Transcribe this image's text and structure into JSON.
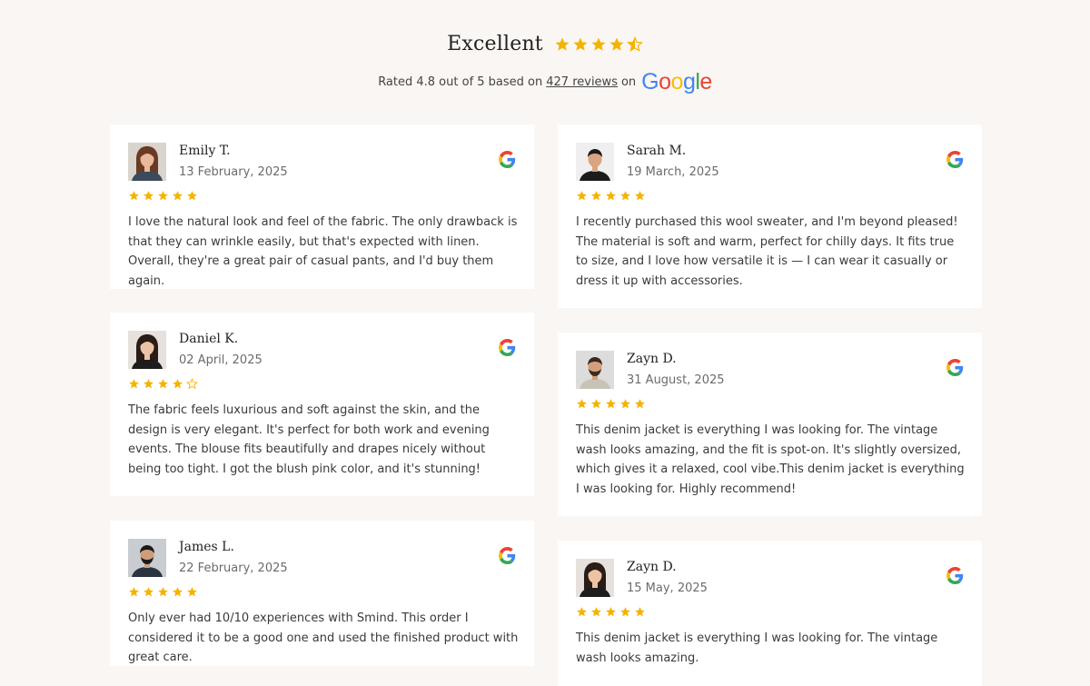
{
  "header": {
    "title": "Excellent",
    "overall_rating": 4.5,
    "rated_prefix": "Rated 4.8 out of 5 based on",
    "reviews_link": "427 reviews",
    "on_text": "on",
    "google_letters": [
      "G",
      "o",
      "o",
      "g",
      "l",
      "e"
    ],
    "google_colors": [
      "#4285F4",
      "#EA4335",
      "#FBBC05",
      "#4285F4",
      "#34A853",
      "#EA4335"
    ]
  },
  "colors": {
    "star": "#f5b301",
    "background": "#faf6f3",
    "card": "#ffffff"
  },
  "reviews": [
    {
      "name": "Emily T.",
      "date": "13 February, 2025",
      "rating": 5,
      "text": "I love the natural look and feel of the fabric. The only drawback is that they can wrinkle easily, but that's expected with linen. Overall, they're a great pair of casual pants, and I'd buy them again."
    },
    {
      "name": "Sarah M.",
      "date": "19 March, 2025",
      "rating": 5,
      "text": "I recently purchased this wool sweater, and I'm beyond pleased! The material is soft and warm, perfect for chilly days. It fits true to size, and I love how versatile it is — I can wear it casually or dress it up with accessories."
    },
    {
      "name": "Daniel K.",
      "date": "02 April, 2025",
      "rating": 4,
      "text": "The fabric feels luxurious and soft against the skin, and the design is very elegant. It's perfect for both work and evening events. The blouse fits beautifully and drapes nicely without being too tight. I got the blush pink color, and it's stunning!"
    },
    {
      "name": "Zayn D.",
      "date": "31 August, 2025",
      "rating": 5,
      "text": "This denim jacket is everything I was looking for. The vintage wash looks amazing, and the fit is spot-on. It's slightly oversized, which gives it a relaxed, cool vibe.This denim jacket is everything I was looking for. Highly recommend!"
    },
    {
      "name": "James L.",
      "date": "22 February, 2025",
      "rating": 5,
      "text": "Only ever had 10/10 experiences with Smind. This order I considered it to be a good one and used the finished product with great care."
    },
    {
      "name": "Zayn D.",
      "date": "15 May, 2025",
      "rating": 5,
      "text": "This denim jacket is everything I was looking for. The vintage wash looks amazing."
    }
  ]
}
